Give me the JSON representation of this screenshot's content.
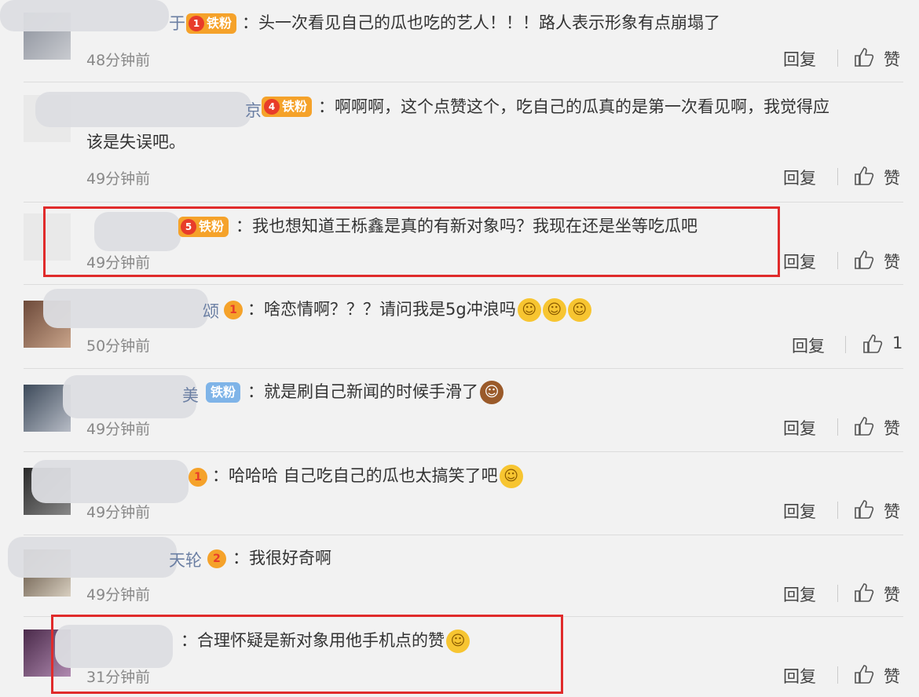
{
  "comments": [
    {
      "name_tail": "于",
      "badge_level": "1",
      "badge_text": "铁粉",
      "text": "：头一次看见自己的瓜也吃的艺人！！！路人表示形象有点崩塌了",
      "time": "48分钟前",
      "reply": "回复",
      "like": "赞"
    },
    {
      "name_tail": "京",
      "badge_level": "4",
      "badge_text": "铁粉",
      "text": "：啊啊啊，这个点赞这个，吃自己的瓜真的是第一次看见啊，我觉得应",
      "text2": "该是失误吧。",
      "time": "49分钟前",
      "reply": "回复",
      "like": "赞"
    },
    {
      "name_tail": "",
      "badge_level": "5",
      "badge_text": "铁粉",
      "text": "：我也想知道王栎鑫是真的有新对象吗？我现在还是坐等吃瓜吧",
      "time": "49分钟前",
      "reply": "回复",
      "like": "赞"
    },
    {
      "name_tail": "颂",
      "badge_level": "1",
      "badge_text": "",
      "text": "：啥恋情啊？？？请问我是5g冲浪吗",
      "time": "50分钟前",
      "reply": "回复",
      "like": "1"
    },
    {
      "name_tail": "美",
      "badge_level": "",
      "badge_text": "铁粉",
      "text": "：就是刷自己新闻的时候手滑了",
      "time": "49分钟前",
      "reply": "回复",
      "like": "赞"
    },
    {
      "name_tail": "",
      "badge_level": "1",
      "badge_text": "",
      "text": "：哈哈哈  自己吃自己的瓜也太搞笑了吧",
      "time": "49分钟前",
      "reply": "回复",
      "like": "赞"
    },
    {
      "name_tail": "天轮",
      "badge_level": "2",
      "badge_text": "",
      "text": "：我很好奇啊",
      "time": "49分钟前",
      "reply": "回复",
      "like": "赞"
    },
    {
      "name_tail": "",
      "badge_level": "",
      "badge_text": "",
      "text": "：合理怀疑是新对象用他手机点的赞",
      "time": "31分钟前",
      "reply": "回复",
      "like": "赞"
    }
  ],
  "icons": {
    "thumb": "thumbs-up-icon",
    "crown": "crown-icon",
    "emoji": "emoji-icon"
  },
  "colors": {
    "highlight": "#e02b2b",
    "badge": "#f5a22a",
    "badge_blue": "#7fb4e8"
  }
}
